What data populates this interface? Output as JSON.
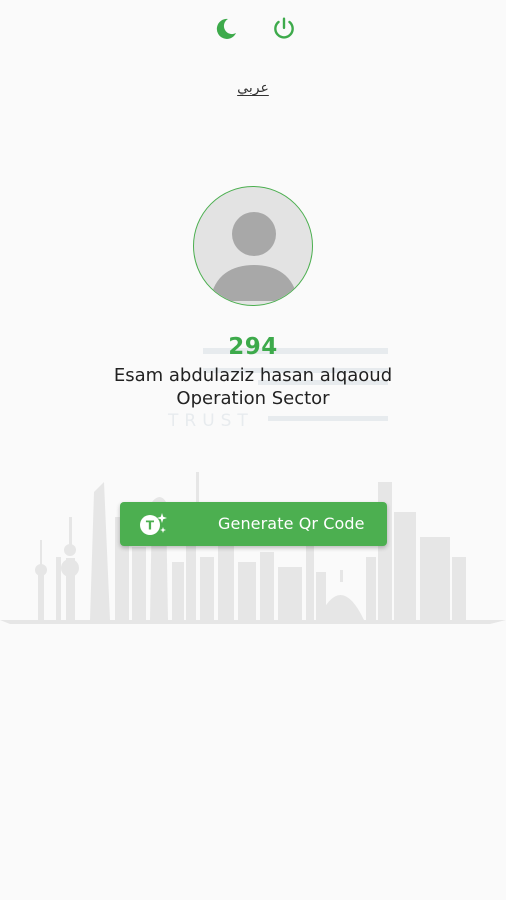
{
  "header": {
    "theme_icon": "moon-icon",
    "logout_icon": "power-icon",
    "accent_color": "#3daa4b"
  },
  "language": {
    "label": "عربي"
  },
  "profile": {
    "avatar_icon": "default-avatar-icon",
    "employee_id": "294",
    "name": "Esam abdulaziz hasan alqaoud",
    "sector": "Operation Sector"
  },
  "watermark": {
    "text": "TRUST"
  },
  "actions": {
    "generate_label": "Generate Qr Code",
    "generate_icon": "qr-sparkle-icon",
    "button_color": "#4caf50"
  }
}
